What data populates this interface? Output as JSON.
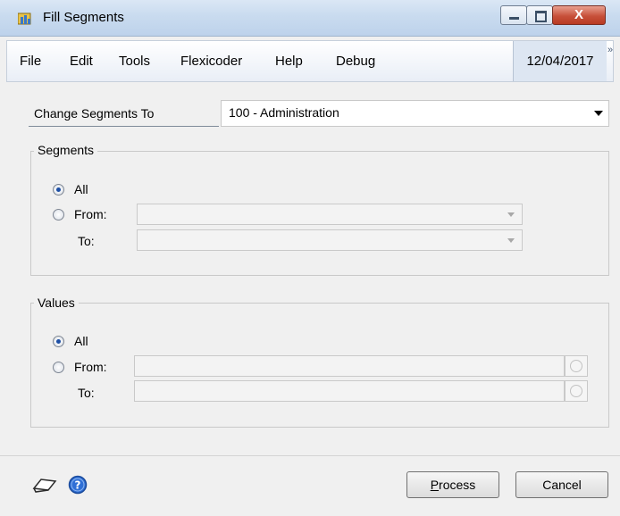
{
  "window": {
    "title": "Fill Segments",
    "close_glyph": "X"
  },
  "menu": {
    "items": [
      "File",
      "Edit",
      "Tools",
      "Flexicoder",
      "Help",
      "Debug"
    ],
    "date": "12/04/2017",
    "overflow": "»"
  },
  "change_segments": {
    "label": "Change Segments To",
    "value": "100 - Administration"
  },
  "segments": {
    "title": "Segments",
    "option_all": "All",
    "option_from": "From:",
    "to_label": "To:",
    "selected": "All",
    "from_value": "",
    "to_value": ""
  },
  "values": {
    "title": "Values",
    "option_all": "All",
    "option_from": "From:",
    "to_label": "To:",
    "selected": "All",
    "from_value": "",
    "to_value": ""
  },
  "footer": {
    "process_prefix": "P",
    "process_rest": "rocess",
    "cancel_label": "Cancel",
    "icons": [
      "note-icon",
      "help-icon"
    ]
  }
}
